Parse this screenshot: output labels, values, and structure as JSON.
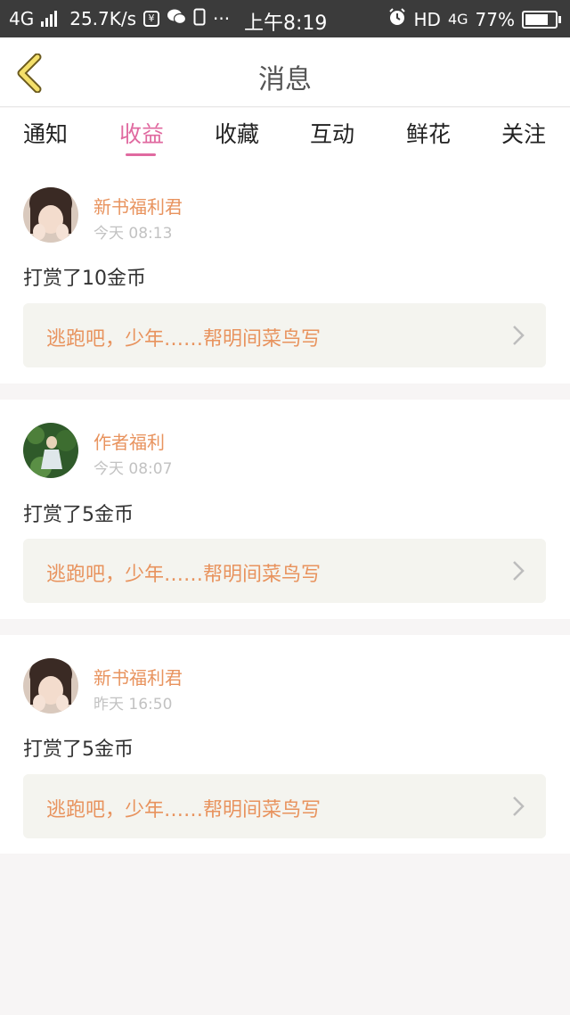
{
  "status_bar": {
    "network": "4G",
    "speed": "25.7K/s",
    "time": "上午8:19",
    "hd": "HD",
    "network_right": "4G",
    "battery": "77%",
    "battery_level": 0.77
  },
  "header": {
    "title": "消息"
  },
  "tabs": [
    {
      "label": "通知"
    },
    {
      "label": "收益"
    },
    {
      "label": "收藏"
    },
    {
      "label": "互动"
    },
    {
      "label": "鲜花"
    },
    {
      "label": "关注"
    }
  ],
  "active_tab": "收益",
  "messages": [
    {
      "name": "新书福利君",
      "time": "今天 08:13",
      "text": "打赏了10金币",
      "book": "逃跑吧，少年……帮明间菜鸟写"
    },
    {
      "name": "作者福利",
      "time": "今天 08:07",
      "text": "打赏了5金币",
      "book": "逃跑吧，少年……帮明间菜鸟写"
    },
    {
      "name": "新书福利君",
      "time": "昨天 16:50",
      "text": "打赏了5金币",
      "book": "逃跑吧，少年……帮明间菜鸟写"
    }
  ],
  "colors": {
    "accent_pink": "#e06aa0",
    "name_orange": "#e8935e",
    "status_bar": "#3b3b3b"
  }
}
